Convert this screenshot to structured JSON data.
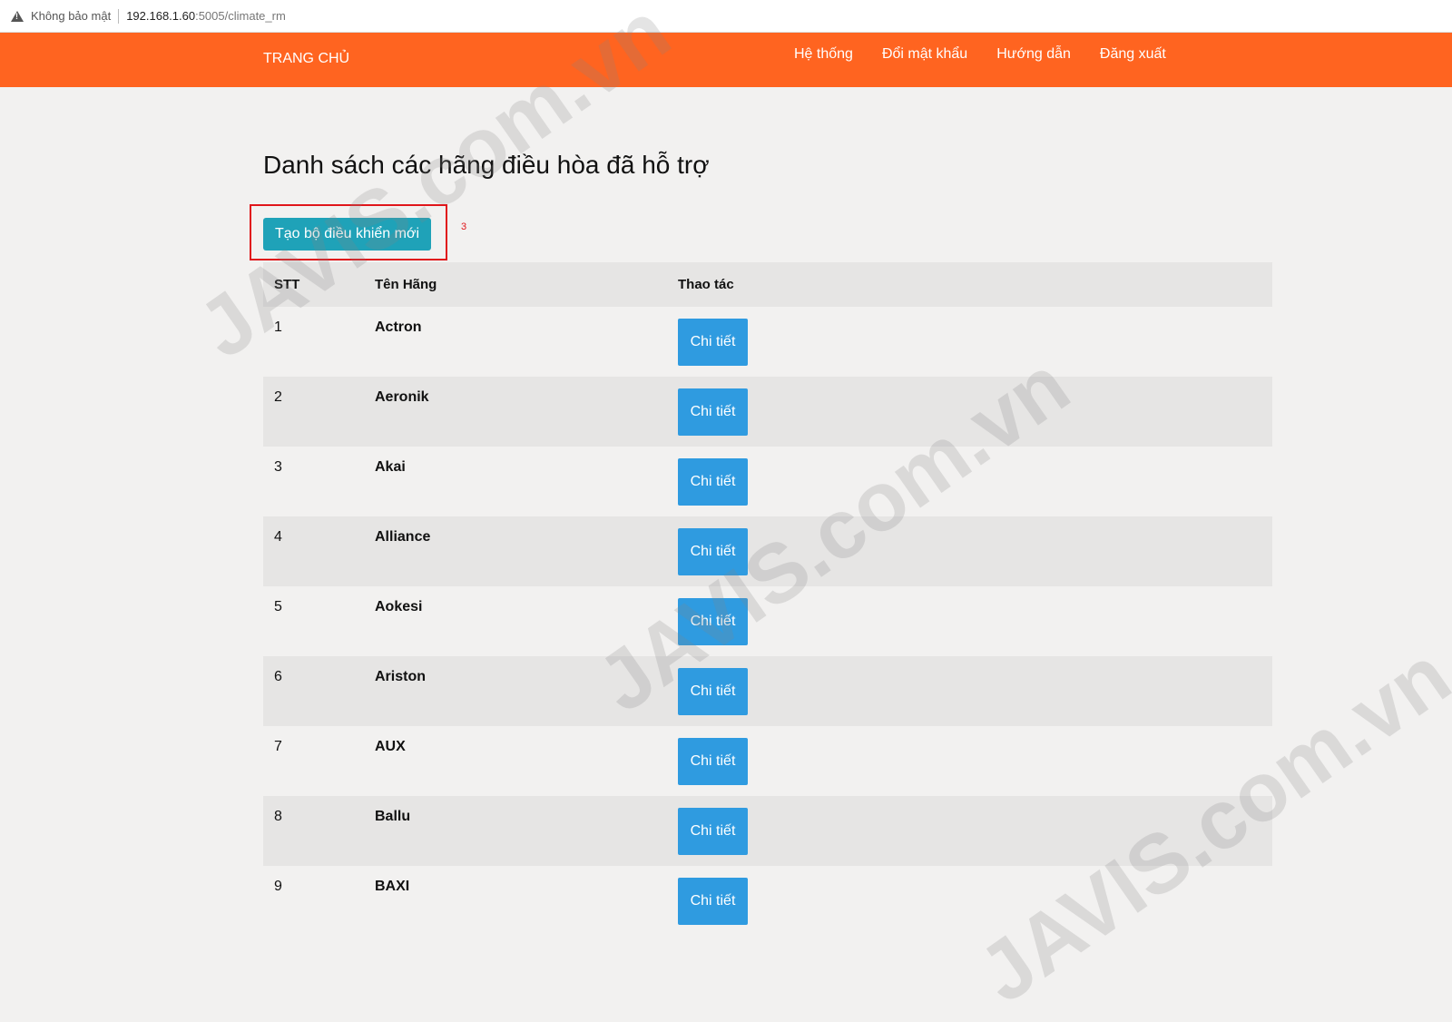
{
  "browser": {
    "security_label": "Không bảo mật",
    "url_host": "192.168.1.60",
    "url_path": ":5005/climate_rm"
  },
  "navbar": {
    "brand": "TRANG CHỦ",
    "links": [
      "Hệ thống",
      "Đổi mật khẩu",
      "Hướng dẫn",
      "Đăng xuất"
    ],
    "color": "#ff6420"
  },
  "page": {
    "title": "Danh sách các hãng điều hòa đã hỗ trợ",
    "create_button": "Tạo bộ điều khiển mới",
    "annotation": "3"
  },
  "table": {
    "headers": [
      "STT",
      "Tên Hãng",
      "Thao tác"
    ],
    "action_label": "Chi tiết",
    "rows": [
      {
        "stt": "1",
        "name": "Actron"
      },
      {
        "stt": "2",
        "name": "Aeronik"
      },
      {
        "stt": "3",
        "name": "Akai"
      },
      {
        "stt": "4",
        "name": "Alliance"
      },
      {
        "stt": "5",
        "name": "Aokesi"
      },
      {
        "stt": "6",
        "name": "Ariston"
      },
      {
        "stt": "7",
        "name": "AUX"
      },
      {
        "stt": "8",
        "name": "Ballu"
      },
      {
        "stt": "9",
        "name": "BAXI"
      }
    ]
  },
  "watermark": "JAVIS.com.vn"
}
